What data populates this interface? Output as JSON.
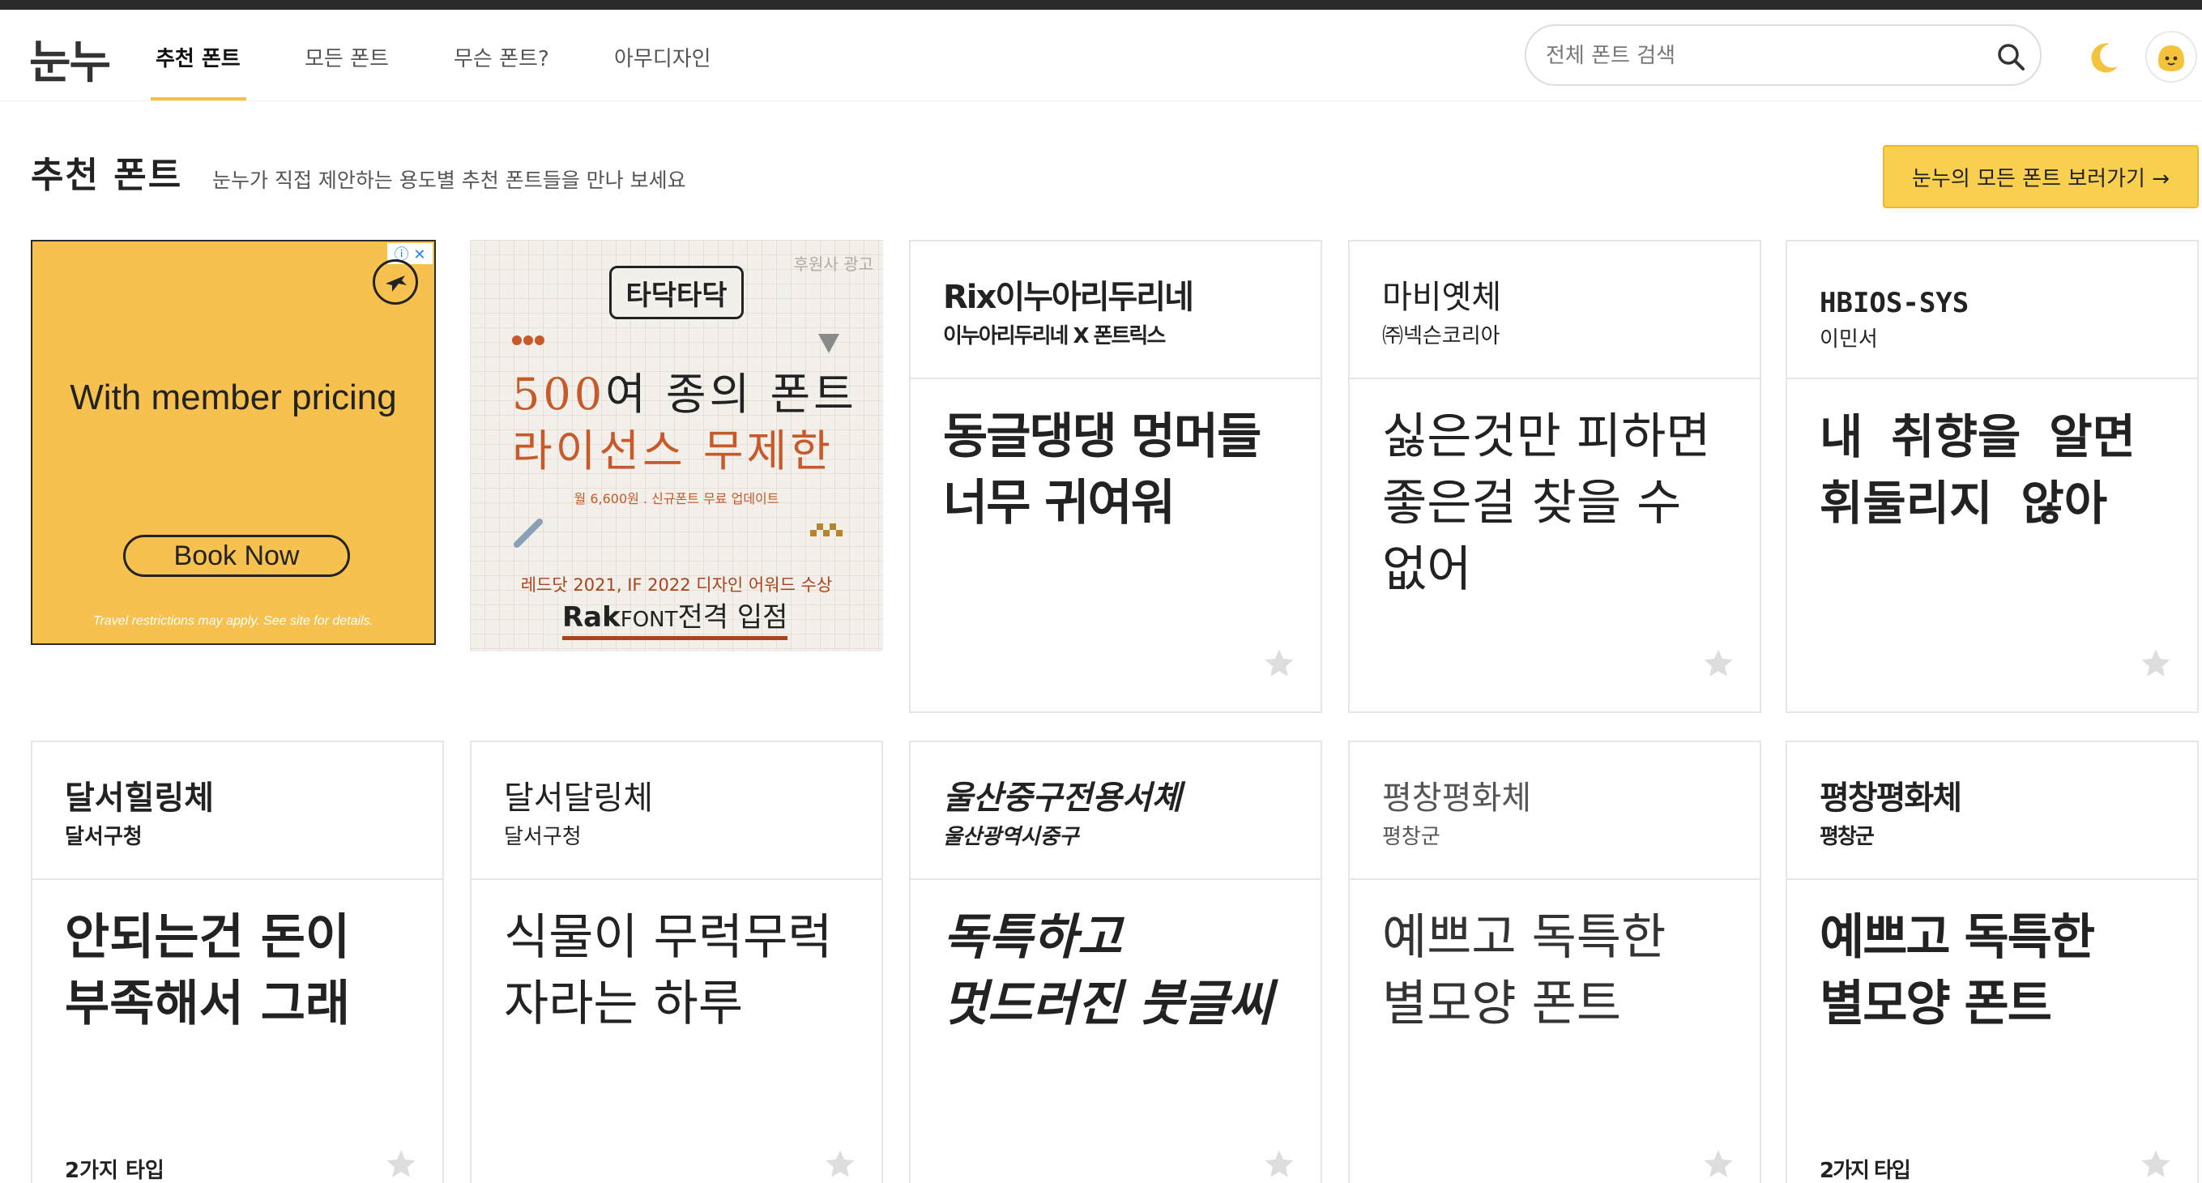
{
  "header": {
    "logo": "눈누",
    "tabs": [
      {
        "label": "추천 폰트",
        "active": true
      },
      {
        "label": "모든 폰트",
        "active": false
      },
      {
        "label": "무슨 폰트?",
        "active": false
      },
      {
        "label": "아무디자인",
        "active": false
      }
    ],
    "search_placeholder": "전체 폰트 검색"
  },
  "section": {
    "title": "추천 폰트",
    "subtitle": "눈누가 직접 제안하는 용도별 추천 폰트들을 만나 보세요",
    "all_fonts_button": "눈누의 모든 폰트 보러가기 →"
  },
  "ads": {
    "ad1": {
      "badge": "ⓘ ✕",
      "headline": "With member pricing",
      "button": "Book Now",
      "footnote": "Travel restrictions may apply. See site for details."
    },
    "ad2": {
      "label": "후원사 광고",
      "logo": "타닥타닥",
      "line1_number": "500",
      "line1_rest": "여 종의 폰트",
      "line2": "라이선스 무제한",
      "price": "월 6,600원 . 신규폰트 무료 업데이트",
      "award": "레드닷 2021, IF 2022 디자인 어워드 수상",
      "rak_brand": "Rak",
      "rak_font": "FONT",
      "rak_rest": "전격 입점"
    }
  },
  "cards_row1": [
    {
      "name": "Rix이누아리두리네",
      "maker": "이누아리두리네 X 폰트릭스",
      "sample": "동글댕댕 멍머들 너무 귀여워",
      "types": ""
    },
    {
      "name": "마비옛체",
      "maker": "㈜넥슨코리아",
      "sample": "싫은것만 피하면 좋은걸 찾을 수 없어",
      "types": ""
    },
    {
      "name": "HBIOS-SYS",
      "maker": "이민서",
      "sample": "내 취향을 알면 휘둘리지 않아",
      "types": ""
    }
  ],
  "cards_row2": [
    {
      "name": "달서힐링체",
      "maker": "달서구청",
      "sample": "안되는건 돈이 부족해서 그래",
      "types": "2가지 타입"
    },
    {
      "name": "달서달링체",
      "maker": "달서구청",
      "sample": "식물이 무럭무럭 자라는 하루",
      "types": ""
    },
    {
      "name": "울산중구전용서체",
      "maker": "울산광역시중구",
      "sample": "독특하고 멋드러진 붓글씨",
      "types": ""
    },
    {
      "name": "평창평화체",
      "maker": "평창군",
      "sample": "예쁘고 독특한 별모양 폰트",
      "types": ""
    },
    {
      "name": "평창평화체",
      "maker": "평창군",
      "sample": "예쁘고 독특한 별모양 폰트",
      "types": "2가지 타입"
    }
  ],
  "colors": {
    "accent": "#f5c23c",
    "button_bg": "#f8cf4f",
    "ad_yellow": "#f6c14e",
    "ad_orange": "#c65a2a",
    "star": "#dddddd"
  }
}
